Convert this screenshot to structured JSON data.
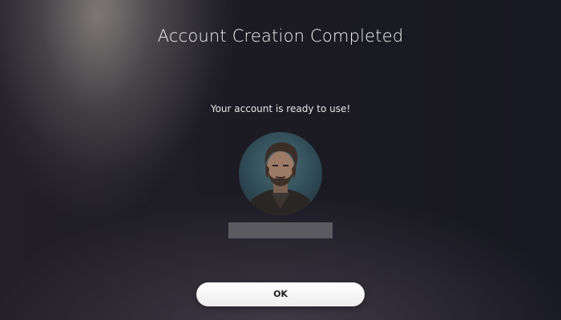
{
  "dialog": {
    "title": "Account Creation Completed",
    "message": "Your account is ready to use!",
    "avatar_icon": "user-avatar",
    "ok_label": "OK"
  },
  "colors": {
    "background": "#1c1b23",
    "button_bg": "#ffffff",
    "button_text": "#1e1e1e",
    "redacted_bar": "#5b5a60"
  }
}
